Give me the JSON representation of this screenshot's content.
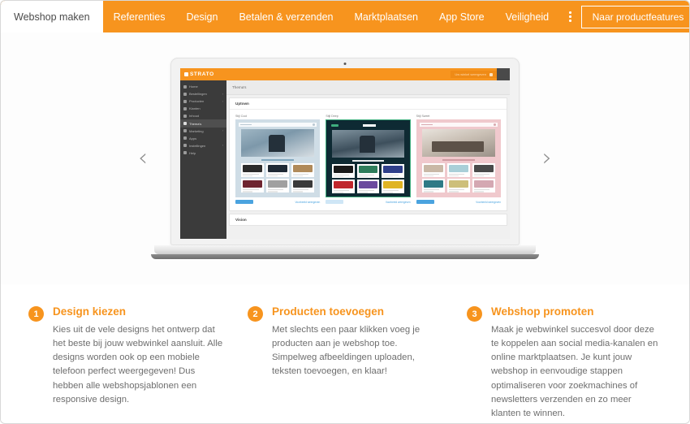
{
  "topnav": {
    "active_tab": "Webshop maken",
    "items": [
      "Referenties",
      "Design",
      "Betalen & verzenden",
      "Marktplaatsen",
      "App Store",
      "Veiligheid"
    ],
    "more_icon": "kebab-menu-icon",
    "cta_label": "Naar productfeatures",
    "cta_arrow": "↓",
    "accent_color": "#f7941e"
  },
  "carousel": {
    "prev_icon": "‹",
    "next_icon": "›"
  },
  "mockup": {
    "app_logo": "STRATO",
    "app_button": "Uw winkel weergeven",
    "sidebar": [
      {
        "label": "Home",
        "has_caret": false,
        "active": false
      },
      {
        "label": "Bestellingen",
        "has_caret": true,
        "active": false
      },
      {
        "label": "Producten",
        "has_caret": true,
        "active": false
      },
      {
        "label": "Klanten",
        "has_caret": false,
        "active": false
      },
      {
        "label": "Inhoud",
        "has_caret": false,
        "active": false
      },
      {
        "label": "Thema's",
        "has_caret": false,
        "active": true
      },
      {
        "label": "Marketing",
        "has_caret": true,
        "active": false
      },
      {
        "label": "Apps",
        "has_caret": false,
        "active": false
      },
      {
        "label": "Instellingen",
        "has_caret": true,
        "active": false
      },
      {
        "label": "Help",
        "has_caret": false,
        "active": false
      }
    ],
    "breadcrumb": "Thema's",
    "section_uptown": "Uptown",
    "section_vision": "Vision",
    "themes": [
      {
        "label": "Stijl Cool",
        "button": "",
        "link": "Voorbeeld weergeven"
      },
      {
        "label": "Stijl Deep",
        "button": "",
        "link": "Voorbeeld weergeven"
      },
      {
        "label": "Stijl Sweet",
        "button": "",
        "link": "Voorbeeld weergeven"
      }
    ]
  },
  "steps": [
    {
      "number": "1",
      "title": "Design kiezen",
      "body": "Kies uit de vele designs het ontwerp dat het beste bij jouw webwinkel aansluit. Alle designs worden ook op een mobiele telefoon perfect weergegeven! Dus hebben alle webshopsjablonen een responsive design."
    },
    {
      "number": "2",
      "title": "Producten toevoegen",
      "body": "Met slechts een paar klikken voeg je producten aan je webshop toe. Simpelweg afbeeldingen uploaden, teksten toevoegen, en klaar!"
    },
    {
      "number": "3",
      "title": "Webshop promoten",
      "body": "Maak je webwinkel succesvol door deze te koppelen aan social media-kanalen en online marktplaatsen. Je kunt jouw webshop in eenvoudige stappen optimaliseren voor zoekmachines of newsletters verzenden en zo meer klanten te winnen."
    }
  ]
}
